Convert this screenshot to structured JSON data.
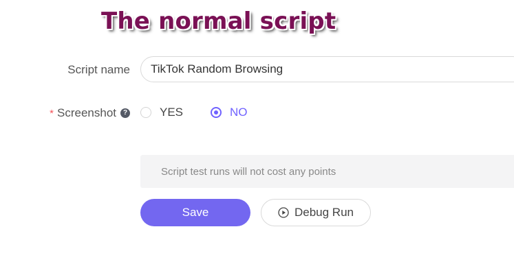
{
  "overlay_title": "The normal script",
  "form": {
    "script_name": {
      "label": "Script name",
      "value": "TikTok Random Browsing"
    },
    "screenshot": {
      "required_mark": "*",
      "label": "Screenshot",
      "help_icon": "question-circle-icon",
      "options": [
        {
          "label": "YES",
          "selected": false
        },
        {
          "label": "NO",
          "selected": true
        }
      ]
    },
    "notice": "Script test runs will not cost any points"
  },
  "actions": {
    "save_label": "Save",
    "debug_label": "Debug Run",
    "debug_icon": "play-circle-icon"
  },
  "colors": {
    "accent": "#7367f0",
    "radio_selected": "#7062ff",
    "required": "#f5545a",
    "overlay_title": "#7a1155"
  }
}
